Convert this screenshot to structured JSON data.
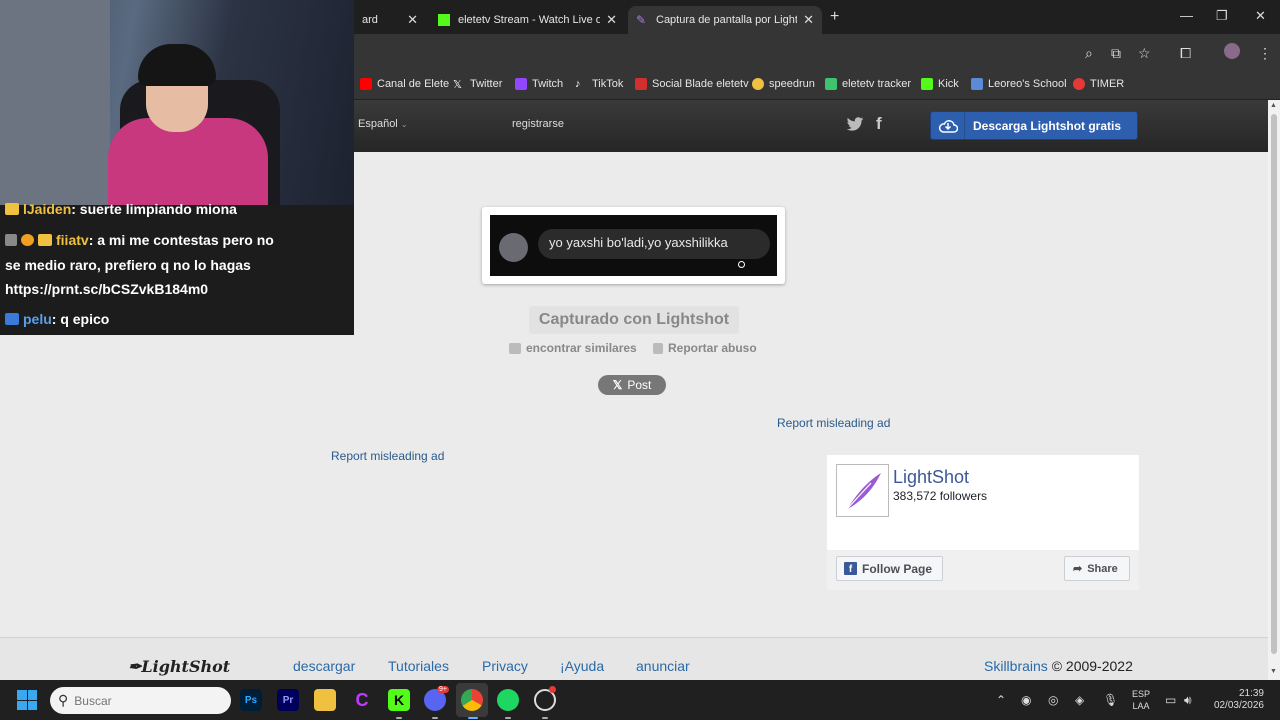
{
  "browser": {
    "tabs": [
      {
        "title": "ard",
        "active": false
      },
      {
        "title": "eletetv Stream - Watch Live on",
        "active": false
      },
      {
        "title": "Captura de pantalla por Lightsh",
        "active": true
      }
    ],
    "bookmarks": [
      {
        "label": "Canal de Elete",
        "color": "#ff0000"
      },
      {
        "label": "Twitter",
        "color": "#ffffff"
      },
      {
        "label": "Twitch",
        "color": "#9146ff"
      },
      {
        "label": "TikTok",
        "color": "#ffffff"
      },
      {
        "label": "Social Blade eletetv",
        "color": "#d32f2f"
      },
      {
        "label": "speedrun",
        "color": "#f0c040"
      },
      {
        "label": "eletetv tracker",
        "color": "#3ec46d"
      },
      {
        "label": "Kick",
        "color": "#53fc18"
      },
      {
        "label": "Leoreo's School",
        "color": "#5a8ad8"
      },
      {
        "label": "TIMER",
        "color": "#e53935"
      }
    ]
  },
  "header": {
    "language": "Español",
    "register": "registrarse",
    "download_button": "Descarga Lightshot gratis"
  },
  "screenshot": {
    "message": "yo yaxshi bo'ladi,yo yaxshilikka"
  },
  "main": {
    "captured_label": "Capturado con Lightshot",
    "find_similar": "encontrar similares",
    "report_abuse": "Reportar abuso",
    "post_button": "Post",
    "misleading_ad_1": "Report misleading ad",
    "misleading_ad_2": "Report misleading ad"
  },
  "facebook_widget": {
    "page_name": "LightShot",
    "followers": "383,572 followers",
    "follow_button": "Follow Page",
    "share_button": "Share"
  },
  "footer": {
    "logo": "LightShot",
    "links": [
      "descargar",
      "Tutoriales",
      "Privacy",
      "¡Ayuda",
      "anunciar"
    ],
    "company": "Skillbrains",
    "copyright": "© 2009-2022"
  },
  "stream_chat": {
    "messages": [
      {
        "user": "lJaiden",
        "text": ": suerte limpiando miona",
        "user_color": "#f0c040"
      },
      {
        "user": "fiiatv",
        "text": ": a mi me contestas pero no",
        "user_color": "#f0c040"
      },
      {
        "continuation_1": "se medio raro, prefiero q no lo hagas",
        "continuation_2": "https://prnt.sc/bCSZvkB184m0"
      },
      {
        "user": "pelu",
        "text": ": q epico",
        "user_color": "#5aa0e8"
      }
    ]
  },
  "taskbar": {
    "search_placeholder": "Buscar",
    "language_line1": "ESP",
    "language_line2": "LAA",
    "time": "21:39",
    "date": "02/03/2026",
    "discord_badge": "9+"
  }
}
